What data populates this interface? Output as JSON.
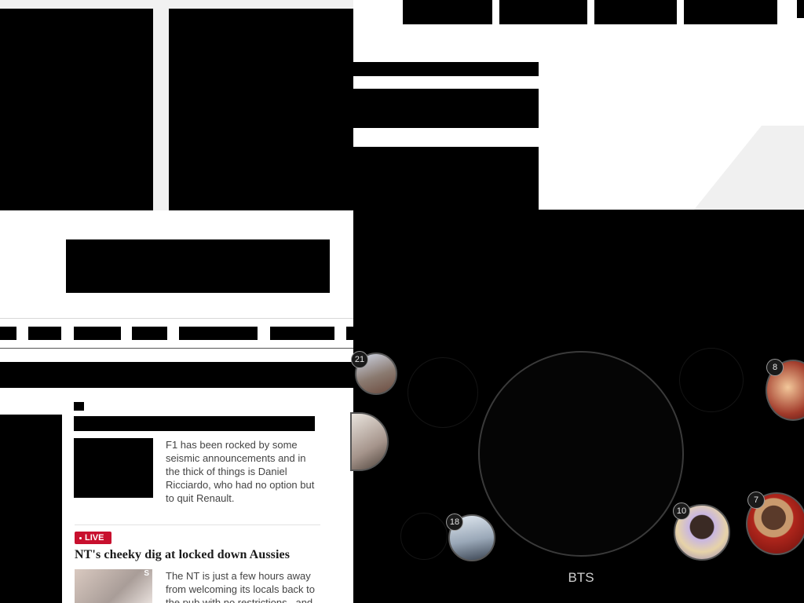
{
  "story_f1": {
    "summary": "F1 has been rocked by some seismic announcements and in the thick of things is Daniel Ricciardo, who had no option but to quit Renault."
  },
  "story_nt": {
    "badge": "LIVE",
    "headline": "NT's cheeky dig at locked down Aussies",
    "summary": "The NT is just a few hours away from welcoming its locals back to the pub with no restrictions...and",
    "thumb_text": "S"
  },
  "artist_chart": {
    "center_label": "BTS",
    "ranks": [
      "21",
      "8",
      "18",
      "10",
      "7"
    ]
  },
  "colors": {
    "live_badge": "#c8102e",
    "dark_panel": "#000000",
    "ring_border": "#3a3a3a"
  }
}
